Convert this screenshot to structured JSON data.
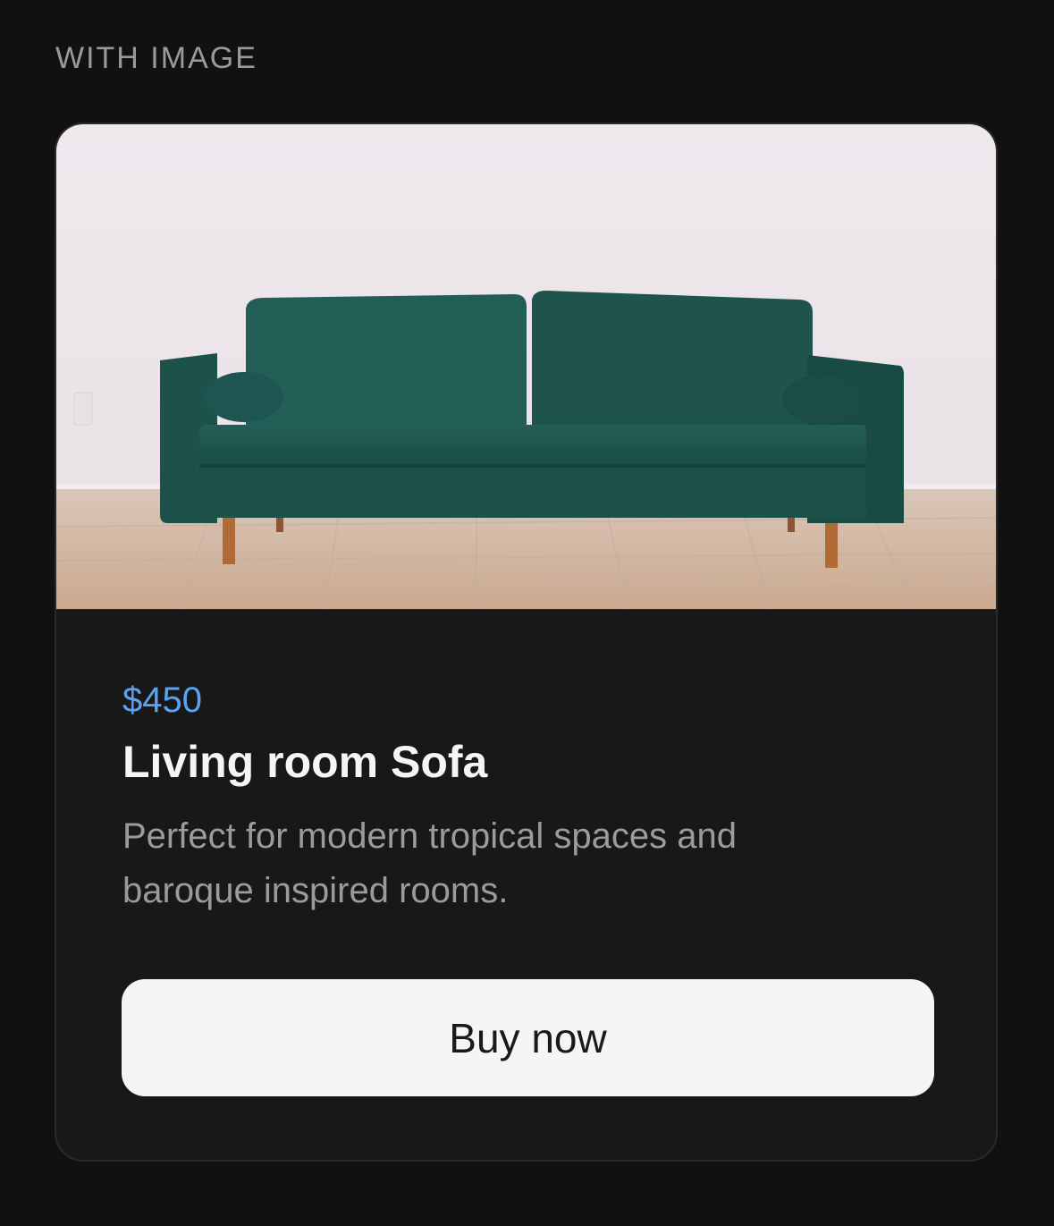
{
  "section": {
    "label": "WITH IMAGE"
  },
  "product": {
    "price": "$450",
    "title": "Living room Sofa",
    "description": "Perfect for modern tropical spaces and baroque inspired rooms.",
    "buy_label": "Buy now",
    "image_icon": "sofa-photo"
  },
  "colors": {
    "background": "#111112",
    "card": "#181818",
    "price": "#5aa2f5",
    "button": "#f5f5f5",
    "sofa": "#1f5a52"
  }
}
